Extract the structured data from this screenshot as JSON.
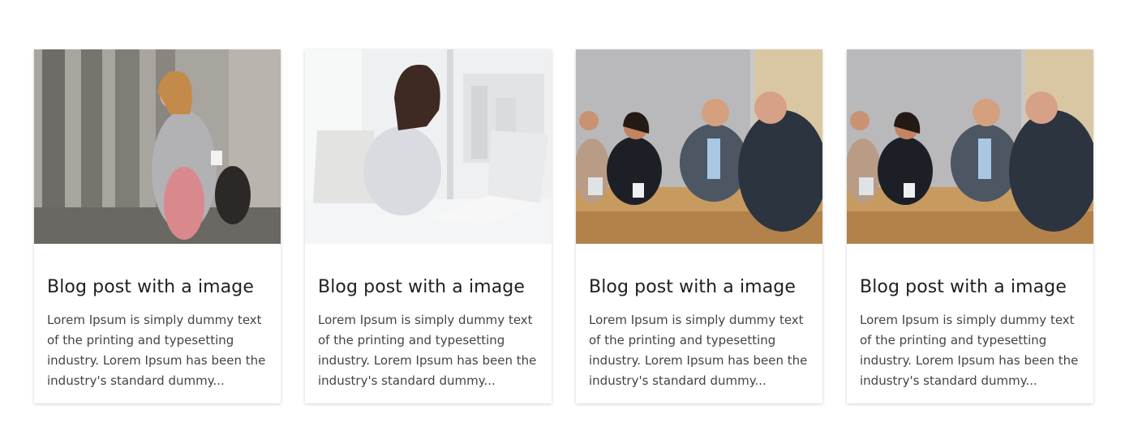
{
  "posts": [
    {
      "image_alt": "woman-on-phone-photo",
      "title": "Blog post with a image",
      "excerpt": "Lorem Ipsum is simply dummy text of the printing and typesetting industry. Lorem Ipsum has been the industry's standard dummy..."
    },
    {
      "image_alt": "woman-at-laptop-photo",
      "title": "Blog post with a image",
      "excerpt": "Lorem Ipsum is simply dummy text of the printing and typesetting industry. Lorem Ipsum has been the industry's standard dummy..."
    },
    {
      "image_alt": "business-meeting-photo",
      "title": "Blog post with a image",
      "excerpt": "Lorem Ipsum is simply dummy text of the printing and typesetting industry. Lorem Ipsum has been the industry's standard dummy..."
    },
    {
      "image_alt": "business-meeting-photo",
      "title": "Blog post with a image",
      "excerpt": "Lorem Ipsum is simply dummy text of the printing and typesetting industry. Lorem Ipsum has been the industry's standard dummy..."
    }
  ]
}
